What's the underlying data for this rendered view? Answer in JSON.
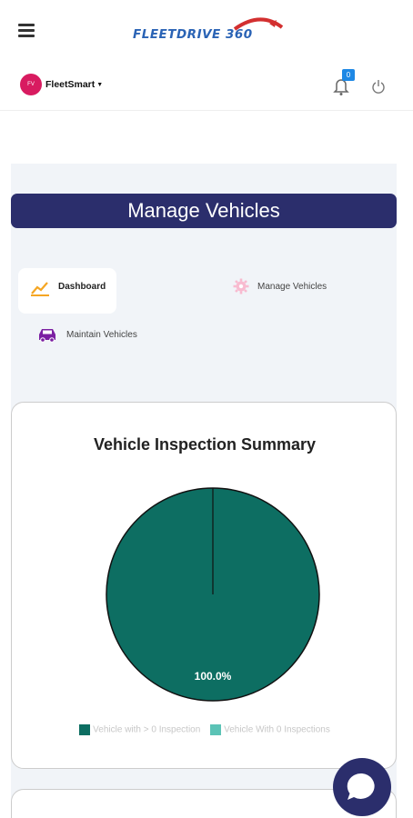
{
  "header": {
    "logo_text": "FLEETDRIVE 360",
    "menu_icon": "hamburger-menu-icon"
  },
  "userbar": {
    "avatar_initials": "FV",
    "account_name": "FleetSmart",
    "notification_count": "0",
    "bell_icon": "bell-icon",
    "power_icon": "power-icon"
  },
  "page": {
    "title": "Manage Vehicles"
  },
  "nav": {
    "items": [
      {
        "label": "Dashboard",
        "icon": "trend-chart-icon",
        "active": true
      },
      {
        "label": "Manage Vehicles",
        "icon": "gear-icon",
        "active": false
      },
      {
        "label": "Maintain Vehicles",
        "icon": "car-icon",
        "active": false
      }
    ]
  },
  "colors": {
    "brand_navy": "#2b2e6c",
    "slice_with_inspection": "#0d6e62",
    "slice_without_inspection": "#5bc3b6",
    "panel_bg": "#f1f4f8"
  },
  "chart_data": {
    "type": "pie",
    "title": "Vehicle Inspection Summary",
    "categories": [
      "Vehicle with > 0 Inspection",
      "Vehicle With 0 Inspections"
    ],
    "values": [
      100.0,
      0.0
    ],
    "data_labels": [
      "100.0%"
    ],
    "legend_placement": "bottom"
  },
  "chat": {
    "icon": "chat-bubble-icon"
  }
}
